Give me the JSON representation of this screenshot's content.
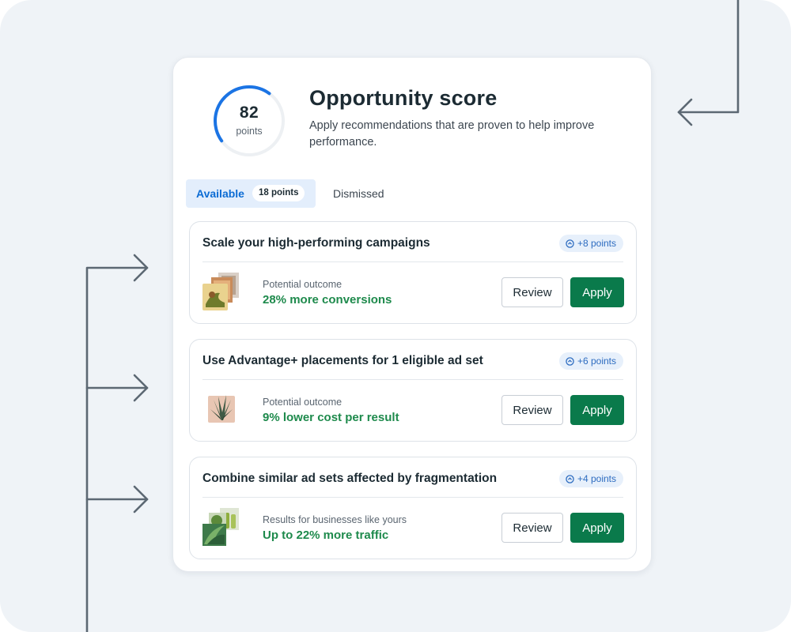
{
  "score": {
    "value": "82",
    "unit": "points",
    "progress_fraction": 0.45,
    "accent_color": "#1b74e4"
  },
  "header": {
    "title": "Opportunity score",
    "subtitle": "Apply recommendations that are proven to help improve performance."
  },
  "tabs": {
    "available_label": "Available",
    "available_badge": "18 points",
    "dismissed_label": "Dismissed"
  },
  "recommendations": [
    {
      "title": "Scale your high-performing campaigns",
      "points": "+8 points",
      "outcome_label": "Potential outcome",
      "outcome_value": "28% more conversions",
      "review_label": "Review",
      "apply_label": "Apply",
      "thumbnail": "stacked-product-images"
    },
    {
      "title": "Use Advantage+ placements for 1 eligible ad set",
      "points": "+6 points",
      "outcome_label": "Potential outcome",
      "outcome_value": "9% lower cost per result",
      "review_label": "Review",
      "apply_label": "Apply",
      "thumbnail": "aloe-plant-image"
    },
    {
      "title": "Combine similar ad sets affected by fragmentation",
      "points": "+4 points",
      "outcome_label": "Results for businesses like yours",
      "outcome_value": "Up to 22% more traffic",
      "review_label": "Review",
      "apply_label": "Apply",
      "thumbnail": "plant-collage-images"
    }
  ],
  "colors": {
    "apply_button": "#0a7a4b",
    "outcome_text": "#1e8a4c",
    "connector_lines": "#5c6873"
  }
}
